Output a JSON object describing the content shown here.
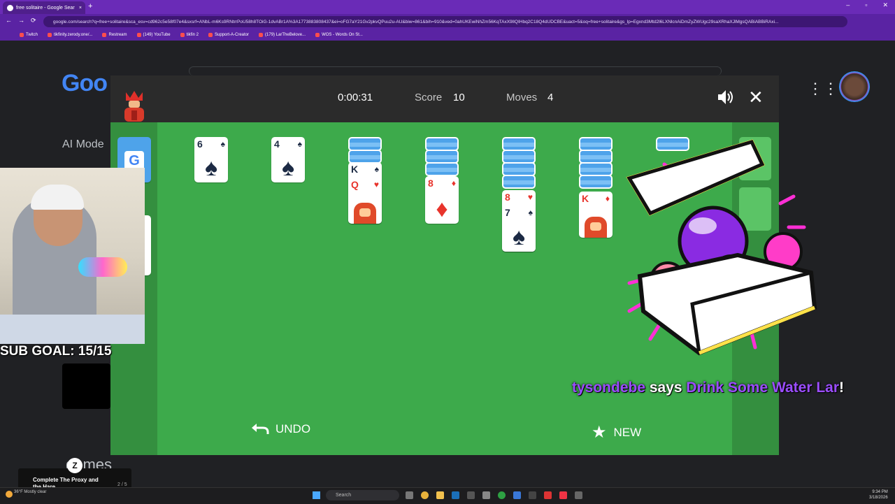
{
  "browser": {
    "tab_title": "free solitaire - Google Sear",
    "tab_close": "×",
    "new_tab": "+",
    "window_controls": [
      "–",
      "▫",
      "✕"
    ],
    "nav": [
      "←",
      "→",
      "⟳"
    ],
    "url": "google.com/search?q=free+solitaire&sca_esv=cd962c5e58f07e4&sxsrf=ANbL-m6Ks9RNtrrPoU58h8TOiG-1dvABr1A%3A1773883808437&ei=oFG7aY21Gv2pkvQPuu2u-AU&biw=861&bih=910&ved=0ahUKEwiNhZm56KqTAxX9lIQIHbq2C18Q4dUDCBE&uact=5&oq=free+solitaire&gs_lp=Egxnd3Mtd2l6LXNlcnAiDmZyZWUgc29saXRhaXJlMgsQABiABBiRAxi...",
    "bookmarks": [
      "Twitch",
      "tikfinity.zerody.one/...",
      "Restream",
      "(149) YouTube",
      "tikfin 2",
      "Support-A-Creator",
      "(179) LarTheBelove...",
      "WOS - Words On St..."
    ]
  },
  "page": {
    "logo_text": "Goo",
    "ai_mode": "AI Mode",
    "apps_icon": "grid-icon"
  },
  "game": {
    "timer": "0:00:31",
    "score_label": "Score",
    "score": "10",
    "moves_label": "Moves",
    "moves": "4",
    "undo_label": "UNDO",
    "new_label": "NEW",
    "close_icon": "✕",
    "stock_glyph": "G",
    "cards": {
      "six_spades": {
        "rank": "6",
        "suit": "♠",
        "pip": "♠"
      },
      "four_spades": {
        "rank": "4",
        "suit": "♠",
        "pip": "♠"
      },
      "king_spades": {
        "rank": "K",
        "suit": "♠"
      },
      "queen_hearts": {
        "rank": "Q",
        "suit": "♥"
      },
      "eight_diamonds": {
        "rank": "8",
        "suit": "♦",
        "pip": "♦"
      },
      "eight_hearts": {
        "rank": "8",
        "suit": "♥"
      },
      "seven_spades": {
        "rank": "7",
        "suit": "♠",
        "pip": "♠"
      },
      "king_diamonds": {
        "rank": "K",
        "suit": "♦"
      }
    },
    "colors": {
      "board": "#3daa4b",
      "card_back": "#4ea3ea",
      "red_suit": "#e8342c",
      "black_suit": "#1c2a44"
    }
  },
  "overlay": {
    "sub_goal": "SUB GOAL: 15/15",
    "chat_user": "tysondebe",
    "chat_says": " says ",
    "chat_text": "Drink Some Water Lar",
    "chat_bang": "!",
    "games_logo": "games",
    "achievement_title": "Complete The Proxy and the Hare",
    "achievement_count": "2 / 5",
    "achievement_progress": 0.4
  },
  "taskbar": {
    "search_placeholder": "Search",
    "weather": "36°F Mostly clear",
    "time": "9:34 PM",
    "date": "3/18/2026"
  }
}
